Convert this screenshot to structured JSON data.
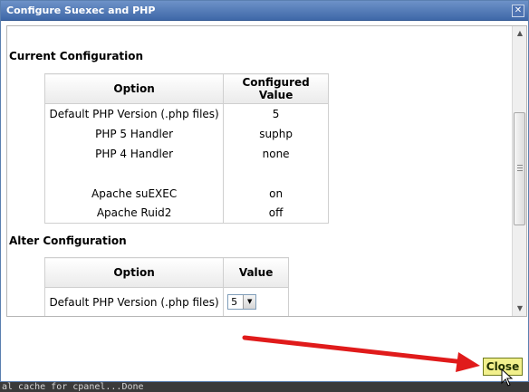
{
  "dialog": {
    "title": "Configure Suexec and PHP",
    "close_icon_glyph": "✕"
  },
  "current": {
    "heading": "Current Configuration",
    "headers": [
      "Option",
      "Configured Value"
    ],
    "rows": [
      {
        "option": "Default PHP Version (.php files)",
        "value": "5"
      },
      {
        "option": "PHP 5 Handler",
        "value": "suphp"
      },
      {
        "option": "PHP 4 Handler",
        "value": "none"
      },
      {
        "option": "",
        "value": ""
      },
      {
        "option": "Apache suEXEC",
        "value": "on"
      },
      {
        "option": "Apache Ruid2",
        "value": "off"
      }
    ]
  },
  "alter": {
    "heading": "Alter Configuration",
    "headers": [
      "Option",
      "Value"
    ],
    "rows": [
      {
        "option": "Default PHP Version (.php files)",
        "select_value": "5"
      }
    ]
  },
  "buttons": {
    "close": "Close"
  },
  "statusbar": {
    "text": "al cache for cpanel...Done"
  },
  "colors": {
    "titlebar": "#4f74b3",
    "close_button": "#f2f08c",
    "annotation_arrow": "#e01b1b"
  },
  "icons": {
    "dialog_close": "close-icon",
    "scroll_up": "arrow-up-icon",
    "scroll_down": "arrow-down-icon",
    "dropdown": "chevron-down-icon",
    "cursor": "mouse-pointer-icon"
  }
}
